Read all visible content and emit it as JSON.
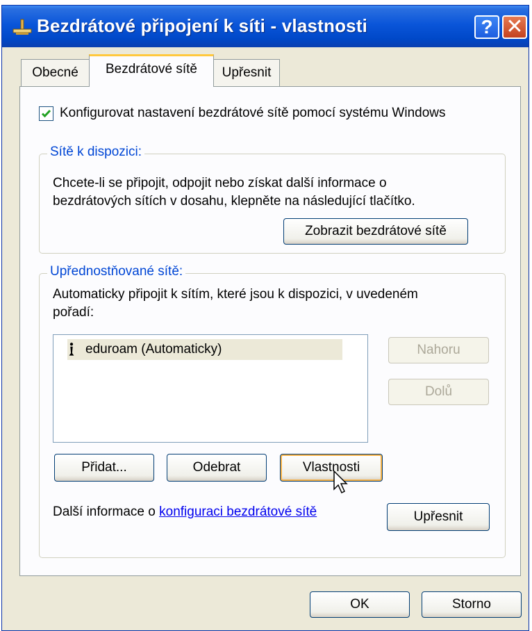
{
  "window": {
    "title": "Bezdrátové připojení k síti - vlastnosti",
    "help_label": "?",
    "close_label": "✕",
    "icon": "network-connection-icon"
  },
  "tabs": [
    {
      "label": "Obecné",
      "active": false
    },
    {
      "label": "Bezdrátové sítě",
      "active": true
    },
    {
      "label": "Upřesnit",
      "active": false
    }
  ],
  "config_checkbox": {
    "label": "Konfigurovat nastavení bezdrátové sítě pomocí systému Windows",
    "checked": true
  },
  "available_networks": {
    "legend": "Sítě k dispozici:",
    "text_line1": "Chcete-li se připojit, odpojit nebo získat další informace o",
    "text_line2": "bezdrátových sítích v dosahu, klepněte na následující tlačítko.",
    "button_label": "Zobrazit bezdrátové sítě"
  },
  "preferred_networks": {
    "legend": "Upřednostňované sítě:",
    "text_line1": "Automaticky připojit k sítím, které jsou k dispozici, v uvedeném",
    "text_line2": "pořadí:",
    "items": [
      {
        "label": "eduroam (Automaticky)",
        "icon": "wireless-antenna-icon",
        "selected": true
      }
    ],
    "up_label": "Nahoru",
    "down_label": "Dolů",
    "add_label": "Přidat...",
    "remove_label": "Odebrat",
    "properties_label": "Vlastnosti",
    "info_prefix": "Další informace o",
    "info_link": "konfiguraci bezdrátové sítě",
    "advanced_label": "Upřesnit"
  },
  "footer": {
    "ok_label": "OK",
    "cancel_label": "Storno"
  },
  "colors": {
    "titlebar": "#0a55d9",
    "dialog_bg": "#ece9d8",
    "legend": "#0046d5",
    "active_tab_accent": "#ffc83c"
  }
}
